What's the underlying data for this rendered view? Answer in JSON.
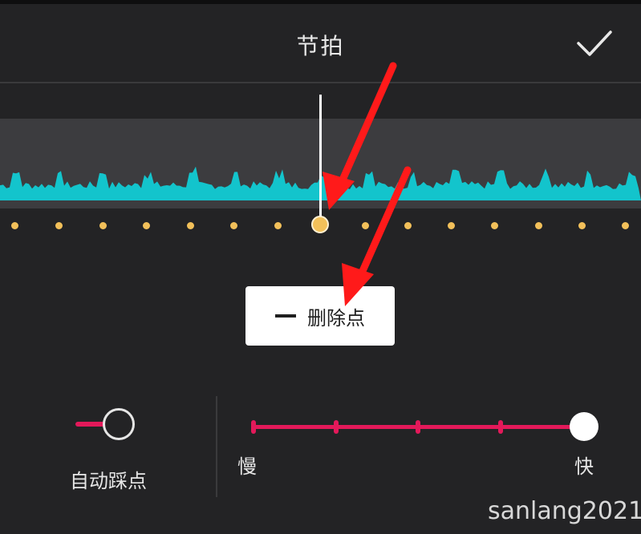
{
  "header": {
    "title": "节拍",
    "confirm_icon": "checkmark-icon"
  },
  "timeline": {
    "waveform_color": "#13c4cc",
    "beat_color": "#f2c05a",
    "selected_beat_index": 7
  },
  "actions": {
    "delete_point_label": "删除点",
    "delete_icon": "minus-icon"
  },
  "auto_beat": {
    "label": "自动踩点",
    "enabled": true
  },
  "speed": {
    "slow_label": "慢",
    "fast_label": "快",
    "level": 5,
    "levels": 5
  },
  "colors": {
    "accent": "#e3195a",
    "background": "#232325",
    "annotation": "#ff1a1a"
  },
  "watermark": "sanlang2021"
}
